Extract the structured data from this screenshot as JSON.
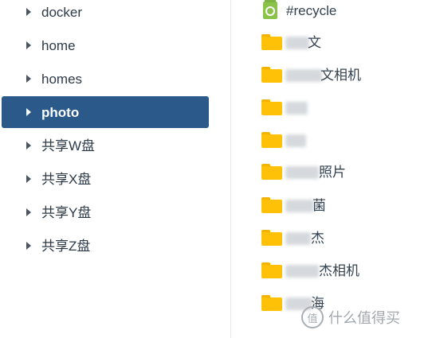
{
  "tree": {
    "items": [
      {
        "label": "docker"
      },
      {
        "label": "home"
      },
      {
        "label": "homes"
      },
      {
        "label": "photo"
      },
      {
        "label": "共享W盘"
      },
      {
        "label": "共享X盘"
      },
      {
        "label": "共享Y盘"
      },
      {
        "label": "共享Z盘"
      }
    ]
  },
  "files": {
    "recycle": {
      "name": "#recycle",
      "icon": "recycle-bin-icon"
    },
    "folders": [
      {
        "visible_suffix": "文"
      },
      {
        "visible_suffix": "文相机"
      },
      {
        "visible_suffix": ""
      },
      {
        "visible_suffix": ""
      },
      {
        "visible_suffix": "照片"
      },
      {
        "visible_suffix": "菌"
      },
      {
        "visible_suffix": "杰"
      },
      {
        "visible_suffix": "杰相机"
      },
      {
        "visible_suffix": "海"
      }
    ]
  },
  "watermark": {
    "icon_text": "值",
    "text": "什么值得买"
  },
  "colors": {
    "selected_background": "#2b5a8a",
    "folder_yellow": "#ffc107",
    "recycle_green": "#8bc34a"
  }
}
